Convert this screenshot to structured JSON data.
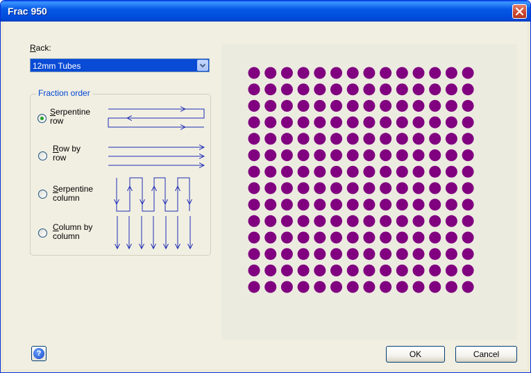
{
  "window": {
    "title": "Frac 950"
  },
  "rack": {
    "label": "Rack:",
    "selected": "12mm Tubes"
  },
  "fraction_order": {
    "title": "Fraction order",
    "options": [
      {
        "line1": "Serpentine",
        "line2": "row",
        "checked": true
      },
      {
        "line1": "Row by",
        "line2": "row",
        "checked": false
      },
      {
        "line1": "Serpentine",
        "line2": "column",
        "checked": false
      },
      {
        "line1": "Column by",
        "line2": "column",
        "checked": false
      }
    ]
  },
  "rack_preview": {
    "rows": 14,
    "columns": 14,
    "tube_color": "#800080"
  },
  "buttons": {
    "ok": "OK",
    "cancel": "Cancel"
  },
  "colors": {
    "title_bar": "#0054e3",
    "selection": "#0a4bd6",
    "accent_text": "#0046d5",
    "diagram_lines": "#1f2eb5"
  }
}
